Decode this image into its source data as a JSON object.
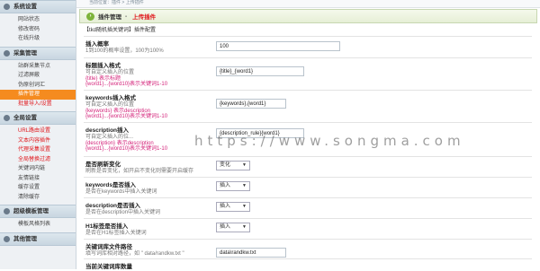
{
  "topbar": {
    "text": "当前位置：插件 > 上传插件"
  },
  "sidebar": {
    "sections": [
      {
        "title": "系统设置",
        "items": [
          {
            "label": "网站状态"
          },
          {
            "label": "修改密码"
          },
          {
            "label": "在线升级"
          }
        ]
      },
      {
        "title": "采集管理",
        "items": [
          {
            "label": "站群采集节点"
          },
          {
            "label": "过滤屏蔽"
          },
          {
            "label": "伪原创词汇"
          },
          {
            "label": "插件管理",
            "active": true
          },
          {
            "label": "批量导入/设置",
            "red": true
          }
        ]
      },
      {
        "title": "全局设置",
        "items": [
          {
            "label": "URL路由设置",
            "red": true
          },
          {
            "label": "文本内容插件",
            "red": true
          },
          {
            "label": "代理采集设置",
            "red": true
          },
          {
            "label": "全局替换过滤",
            "red": true
          },
          {
            "label": "关键词内链"
          },
          {
            "label": "友情链接"
          },
          {
            "label": "缓存设置"
          },
          {
            "label": "清除缓存"
          }
        ]
      },
      {
        "title": "超级模板管理",
        "items": [
          {
            "label": "模板风格列表"
          }
        ]
      },
      {
        "title": "其他管理",
        "items": []
      }
    ]
  },
  "header": {
    "breadcrumb_root": "插件管理",
    "separator": "-",
    "current": "上传插件"
  },
  "form": {
    "title": "【tkd随机插关键词】插件配置",
    "rows": [
      {
        "label": "插入概率",
        "desc": [
          "1到100的概率设置，100为100%"
        ],
        "type": "text",
        "value": "100"
      },
      {
        "label": "标题插入格式",
        "desc": [
          "可自定义插入的位置",
          "{title} 表示标题",
          "{word1}...{word10}表示关键词1-10"
        ],
        "type": "text",
        "value": "{title}_{word1}"
      },
      {
        "label": "keywords插入格式",
        "desc": [
          "可自定义插入的位置",
          "{keywords} 表示description",
          "{word1}...{word10}表示关键词1-10"
        ],
        "type": "text",
        "value": "{keywords},{word1}"
      },
      {
        "label": "description插入",
        "desc": [
          "可自定义插入的位...",
          "{description} 表示description",
          "{word1}...{word10}表示关键词1-10"
        ],
        "type": "text",
        "value": "{description_rule}{word1}"
      },
      {
        "label": "是否刷新变化",
        "desc": [
          "刷新是否变化，如开启不变化则需要开启缓存"
        ],
        "type": "select",
        "value": "变化"
      },
      {
        "label": "keywords是否插入",
        "desc": [
          "是否在keywords中插入关键词"
        ],
        "type": "select",
        "value": "插入"
      },
      {
        "label": "description是否插入",
        "desc": [
          "是否在description中插入关键词"
        ],
        "type": "select",
        "value": "插入"
      },
      {
        "label": "H1标签是否插入",
        "desc": [
          "是否在H1标签插入关键词"
        ],
        "type": "select",
        "value": "插入"
      },
      {
        "label": "关键词库文件路径",
        "desc": [
          "填写词库相对路径，如 \" data/randkw.txt \""
        ],
        "type": "text",
        "value": "data\\randkw.txt"
      },
      {
        "label": "当前关键词库数量",
        "desc": [],
        "type": "none",
        "value": ""
      }
    ]
  },
  "watermark": "https://www.songma.com",
  "colors": {
    "accent_orange": "#f58b1f",
    "red": "#e0161b",
    "title_green": "#7db33a"
  }
}
